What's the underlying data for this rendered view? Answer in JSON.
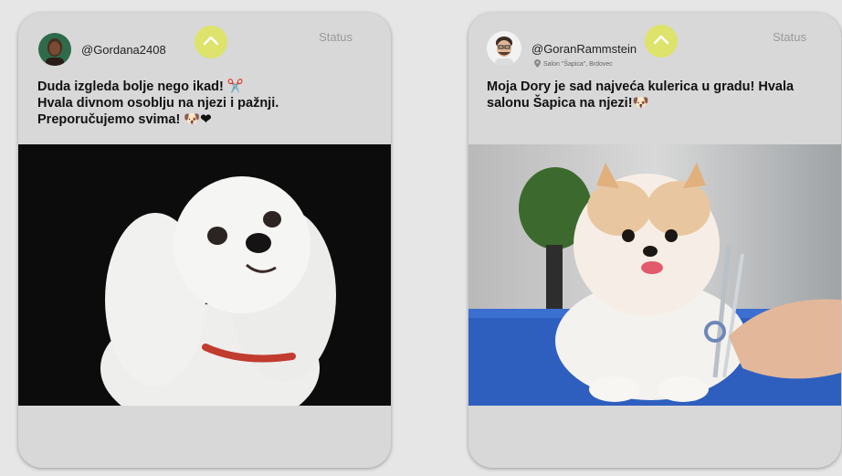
{
  "posts": [
    {
      "username": "@Gordana2408",
      "status": "Status",
      "text_lines": [
        "Duda izgleda bolje nego ikad! ✂️",
        "Hvala divnom osoblju na njezi i pažnji.",
        "Preporučujemo svima! 🐶❤"
      ],
      "photo": "white-maltese-dog-photo"
    },
    {
      "username": "@GoranRammstein",
      "location": "Salon \"Šapica\", Brdovec",
      "status": "Status",
      "text_lines": [
        "Moja Dory je sad najveća kulerica u gradu! Hvala",
        "salonu Šapica na njezi!🐶"
      ],
      "photo": "pomeranian-grooming-photo"
    }
  ],
  "colors": {
    "card_bg": "#d8d8d8",
    "page_bg": "#e6e6e6",
    "accent_button": "#dde36b"
  }
}
